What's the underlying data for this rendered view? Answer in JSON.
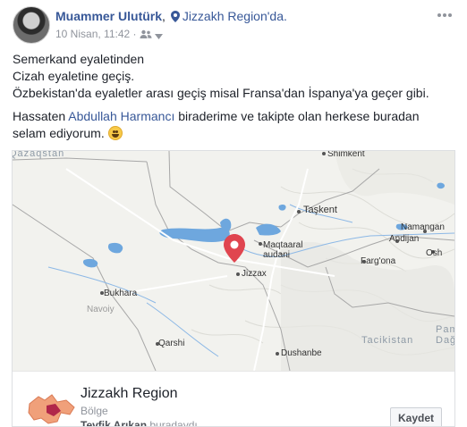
{
  "post": {
    "author": "Muammer Ulutürk",
    "separator": ",",
    "location": "Jizzakh Region'da.",
    "timestamp": "10 Nisan, 11:42",
    "meta_dot": "·",
    "icons": {
      "location": "map-pin-icon",
      "audience": "friends-icon",
      "menu": "chevron-down-icon",
      "more": "more-options-icon"
    },
    "lines": [
      "Semerkand eyaletinden",
      "Cizah eyaletine geçiş.",
      "Özbekistan'da eyaletler arası geçiş misal Fransa'dan İspanya'ya geçer gibi."
    ],
    "greeting_prefix": "Hassaten ",
    "mention": "Abdullah Harmancı",
    "greeting_line1_rest": " biraderime ve takipte olan herkese buradan",
    "greeting_line2": "selam ediyorum. ",
    "emoji": "grinning-face-icon"
  },
  "map": {
    "labels": {
      "kazakhstan": "Qazaqstan",
      "shymkent": "Shimkent",
      "tashkent": "Taşkent",
      "namangan": "Namangan",
      "andijan": "Andijan",
      "osh": "Osh",
      "maqtaaral1": "Maqtaaral",
      "maqtaaral2": "audani",
      "jizzax": "Jizzax",
      "fergana": "Farg'ona",
      "bukhara": "Bukhara",
      "navoiy": "Navoiy",
      "qarshi": "Qarshi",
      "tajikistan": "Tacikistan",
      "pamir1": "Pam",
      "pamir2": "Dağl",
      "dushanbe": "Dushanbe"
    },
    "colors": {
      "water": "#6ea7de",
      "land": "#f2f2ee",
      "pin": "#e0454f",
      "border": "#a7a7a7"
    }
  },
  "place": {
    "name": "Jizzakh Region",
    "category": "Bölge",
    "visitors_name": "Tevfik Arıkan",
    "visitors_rest": " buradaydı",
    "save_label": "Kaydet"
  }
}
